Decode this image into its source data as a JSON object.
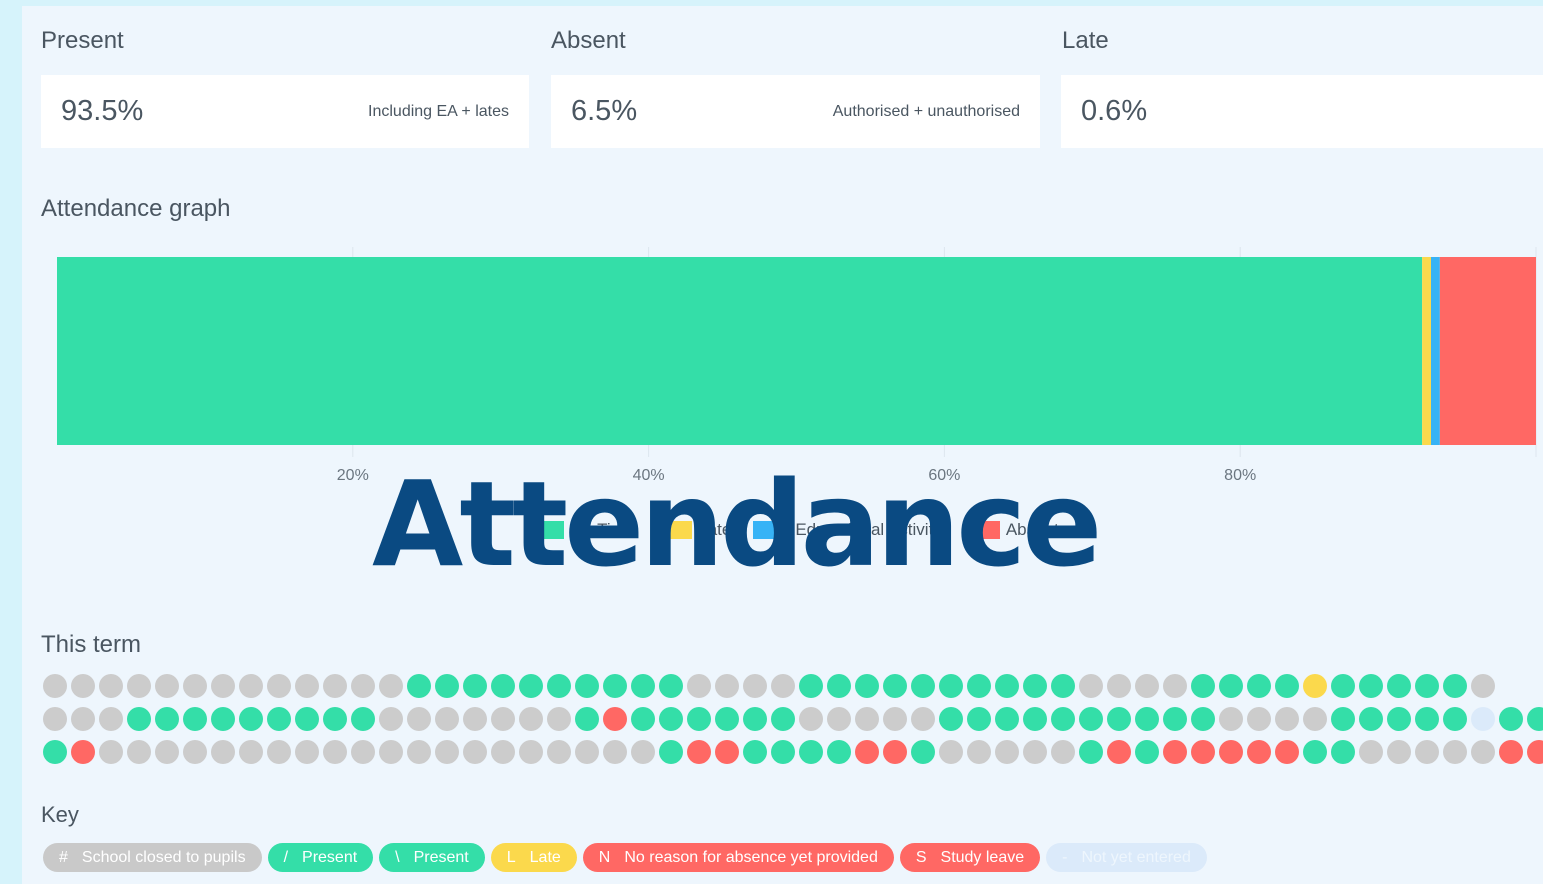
{
  "stats": [
    {
      "label": "Present",
      "value": "93.5%",
      "note": "Including EA + lates"
    },
    {
      "label": "Absent",
      "value": "6.5%",
      "note": "Authorised + unauthorised"
    },
    {
      "label": "Late",
      "value": "0.6%",
      "note": ""
    }
  ],
  "graph_title": "Attendance graph",
  "watermark": "Attendance",
  "chart_data": {
    "type": "bar",
    "orientation": "horizontal-stacked",
    "series": [
      {
        "name": "On Time",
        "values": [
          92.3
        ],
        "color": "#34dea8"
      },
      {
        "name": "Late",
        "values": [
          0.6
        ],
        "color": "#fbd94c"
      },
      {
        "name": "Educational Activity",
        "values": [
          0.6
        ],
        "color": "#37b3f6"
      },
      {
        "name": "Absent",
        "values": [
          6.5
        ],
        "color": "#ff6864"
      }
    ],
    "xlim": [
      0,
      100
    ],
    "xticks": [
      "20%",
      "40%",
      "60%",
      "80%"
    ],
    "legend_position": "bottom"
  },
  "legend": [
    {
      "label": "On Time",
      "color": "#34dea8"
    },
    {
      "label": "Late",
      "color": "#fbd94c"
    },
    {
      "label": "Educational Activity",
      "color": "#37b3f6"
    },
    {
      "label": "Absent",
      "color": "#ff6864"
    }
  ],
  "term_title": "This term",
  "term_rows": [
    "gggggggggggggPPPPPPPPPPggggPPPPPPPPPPggggPPPPLPPPPPg",
    "gggPPPPPPPPPgggggggPNPPPPPPgggggPPPPPPPPPPggggPPPPPnPP",
    "PNggggggggggggggggggggPNNPPPPNNPgggggPNPNNNNNPPgggggNNNN"
  ],
  "dot_colors": {
    "g": "#cccccc",
    "P": "#34dea8",
    "N": "#ff6864",
    "L": "#fbd94c",
    "n": "#dbeafa"
  },
  "key_title": "Key",
  "key_items": [
    {
      "code": "#",
      "label": "School closed to pupils",
      "color": "#c9c9c9"
    },
    {
      "code": "/",
      "label": "Present",
      "color": "#34dea8"
    },
    {
      "code": "\\",
      "label": "Present",
      "color": "#34dea8"
    },
    {
      "code": "L",
      "label": "Late",
      "color": "#fbd94c"
    },
    {
      "code": "N",
      "label": "No reason for absence yet provided",
      "color": "#ff6864"
    },
    {
      "code": "S",
      "label": "Study leave",
      "color": "#ff6864"
    },
    {
      "code": "-",
      "label": "Not yet entered",
      "color": "#dbeafa"
    }
  ]
}
